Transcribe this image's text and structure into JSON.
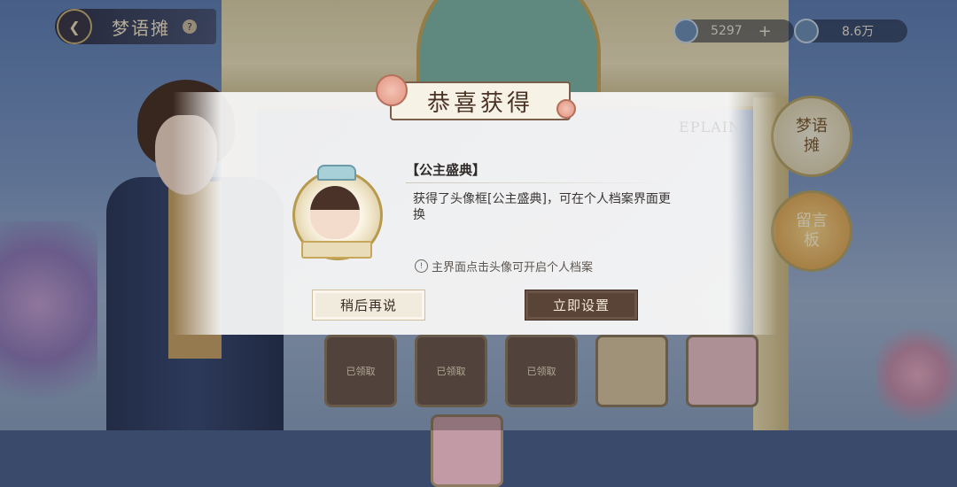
{
  "header": {
    "shop_title": "梦语摊",
    "help_glyph": "?",
    "back_glyph": "❮"
  },
  "currencies": [
    {
      "value": "5297",
      "icon": "gem-icon"
    },
    {
      "value": "8.6万",
      "icon": "coin-icon"
    }
  ],
  "side": {
    "badge1": "梦语摊",
    "badge2": "留言板"
  },
  "slots": [
    "已领取",
    "已领取",
    "已领取",
    "",
    "",
    ""
  ],
  "dialog": {
    "title": "恭喜获得",
    "watermark": "EPLAIN",
    "item_name": "【公主盛典】",
    "description": "获得了头像框[公主盛典]，可在个人档案界面更换",
    "hint": "主界面点击头像可开启个人档案",
    "later_button": "稍后再说",
    "set_button": "立即设置"
  },
  "colors": {
    "confirm": "#5a4438",
    "cancel": "#f1ebdd",
    "title_text": "#4b3227"
  }
}
